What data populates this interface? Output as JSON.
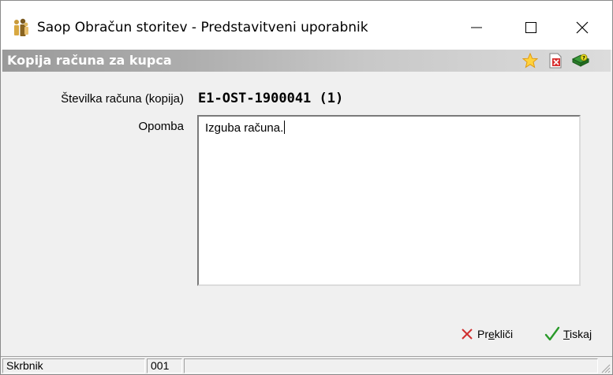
{
  "window": {
    "title": "Saop Obračun storitev - Predstavitveni uporabnik"
  },
  "banner": {
    "title": "Kopija računa za kupca",
    "icons": [
      "star-icon",
      "close-document-icon",
      "help-book-icon"
    ]
  },
  "form": {
    "number_label": "Številka računa (kopija)",
    "number_value": "E1-OST-1900041 (1)",
    "note_label": "Opomba",
    "note_value": "Izguba računa."
  },
  "buttons": {
    "cancel_prefix": "Pr",
    "cancel_accel": "e",
    "cancel_suffix": "kliči",
    "print_accel": "T",
    "print_suffix": "iskaj"
  },
  "status": {
    "user": "Skrbnik",
    "code": "001"
  },
  "colors": {
    "banner_start": "#9a9a9a",
    "banner_end": "#dcdcdc",
    "cancel_red": "#d03030",
    "print_green": "#2a9a2a"
  }
}
